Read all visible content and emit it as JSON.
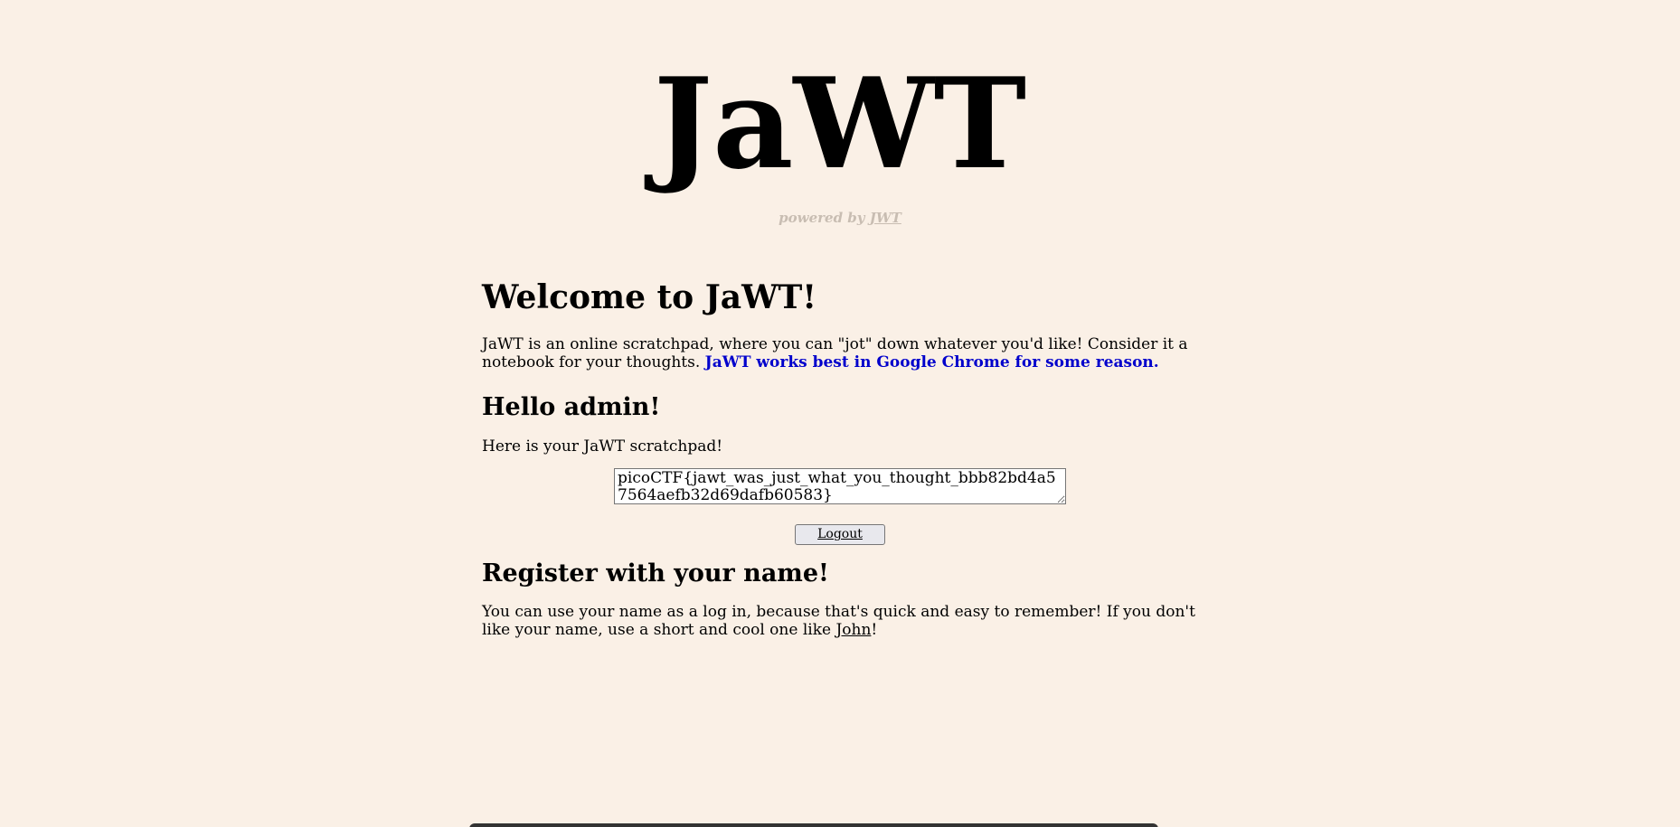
{
  "header": {
    "title": "JaWT",
    "powered_prefix": "powered by ",
    "powered_link": "JWT"
  },
  "welcome": {
    "heading": "Welcome to JaWT!",
    "intro": " JaWT is an online scratchpad, where you can \"jot\" down whatever you'd like! Consider it a notebook for your thoughts. ",
    "chrome_note": "JaWT works best in Google Chrome for some reason."
  },
  "user": {
    "greeting": "Hello admin!",
    "scratchpad_intro": " Here is your JaWT scratchpad!",
    "scratchpad_value": "picoCTF{jawt_was_just_what_you_thought_bbb82bd4a57564aefb32d69dafb60583}",
    "logout_label": "Logout"
  },
  "register": {
    "heading": "Register with your name!",
    "text_before": " You can use your name as a log in, because that's quick and easy to remember! If you don't like your name, use a short and cool one like ",
    "example_link": "John",
    "text_after": "!"
  }
}
